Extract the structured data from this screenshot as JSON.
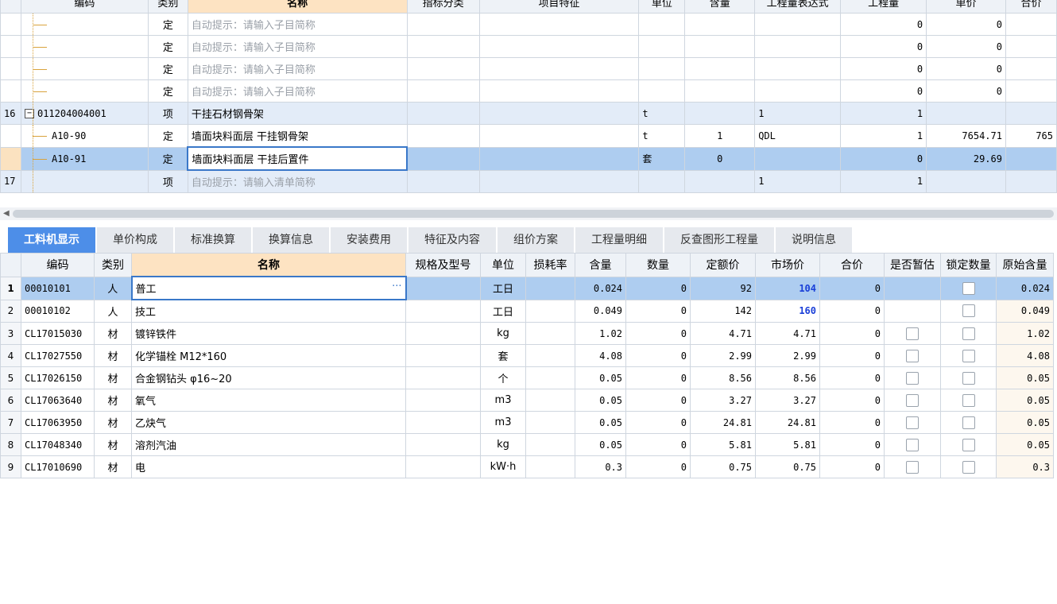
{
  "top_grid": {
    "headers": [
      "编码",
      "类别",
      "名称",
      "指标分类",
      "项目特征",
      "单位",
      "含量",
      "工程量表达式",
      "工程量",
      "单价",
      "合价"
    ],
    "rows": [
      {
        "rownum": "",
        "code": "",
        "kind": "定",
        "name": "自动提示：请输入子目简称",
        "hint": true,
        "unit": "",
        "content": "",
        "expr": "",
        "qty": "0",
        "price": "0",
        "total": "",
        "style": "normal",
        "level": 2
      },
      {
        "rownum": "",
        "code": "",
        "kind": "定",
        "name": "自动提示：请输入子目简称",
        "hint": true,
        "unit": "",
        "content": "",
        "expr": "",
        "qty": "0",
        "price": "0",
        "total": "",
        "style": "normal",
        "level": 2
      },
      {
        "rownum": "",
        "code": "",
        "kind": "定",
        "name": "自动提示：请输入子目简称",
        "hint": true,
        "unit": "",
        "content": "",
        "expr": "",
        "qty": "0",
        "price": "0",
        "total": "",
        "style": "normal",
        "level": 2
      },
      {
        "rownum": "",
        "code": "",
        "kind": "定",
        "name": "自动提示：请输入子目简称",
        "hint": true,
        "unit": "",
        "content": "",
        "expr": "",
        "qty": "0",
        "price": "0",
        "total": "",
        "style": "normal",
        "level": 2
      },
      {
        "rownum": "16",
        "code": "011204004001",
        "kind": "项",
        "name": "干挂石材钢骨架",
        "hint": false,
        "unit": "t",
        "content": "",
        "expr": "1",
        "qty": "1",
        "price": "",
        "total": "",
        "style": "item",
        "level": 1
      },
      {
        "rownum": "",
        "code": "A10-90",
        "kind": "定",
        "name": "墙面块料面层 干挂钢骨架",
        "hint": false,
        "unit": "t",
        "content": "1",
        "expr": "QDL",
        "qty": "1",
        "price": "7654.71",
        "total": "765",
        "style": "normal",
        "level": 2
      },
      {
        "rownum": "",
        "code": "A10-91",
        "kind": "定",
        "name": "墙面块料面层 干挂后置件",
        "hint": false,
        "unit": "套",
        "content": "0",
        "expr": "",
        "qty": "0",
        "price": "29.69",
        "total": "",
        "style": "selected",
        "level": 2
      },
      {
        "rownum": "17",
        "code": "",
        "kind": "项",
        "name": "自动提示：请输入清单简称",
        "hint": true,
        "unit": "",
        "content": "",
        "expr": "1",
        "qty": "1",
        "price": "",
        "total": "",
        "style": "item",
        "level": 1
      }
    ]
  },
  "tabs": [
    "工料机显示",
    "单价构成",
    "标准换算",
    "换算信息",
    "安装费用",
    "特征及内容",
    "组价方案",
    "工程量明细",
    "反查图形工程量",
    "说明信息"
  ],
  "active_tab": 0,
  "bottom_grid": {
    "headers": [
      "编码",
      "类别",
      "名称",
      "规格及型号",
      "单位",
      "损耗率",
      "含量",
      "数量",
      "定额价",
      "市场价",
      "合价",
      "是否暂估",
      "锁定数量",
      "原始含量"
    ],
    "rows": [
      {
        "n": "1",
        "code": "00010101",
        "kind": "人",
        "name": "普工",
        "spec": "",
        "unit": "工日",
        "loss": "",
        "content": "0.024",
        "qty": "0",
        "quota": "92",
        "market": "104",
        "total": "0",
        "est": false,
        "lock": true,
        "orig": "0.024",
        "selected": true,
        "market_blue": true
      },
      {
        "n": "2",
        "code": "00010102",
        "kind": "人",
        "name": "技工",
        "spec": "",
        "unit": "工日",
        "loss": "",
        "content": "0.049",
        "qty": "0",
        "quota": "142",
        "market": "160",
        "total": "0",
        "est": false,
        "lock": true,
        "orig": "0.049",
        "selected": false,
        "market_blue": true
      },
      {
        "n": "3",
        "code": "CL17015030",
        "kind": "材",
        "name": "镀锌铁件",
        "spec": "",
        "unit": "kg",
        "loss": "",
        "content": "1.02",
        "qty": "0",
        "quota": "4.71",
        "market": "4.71",
        "total": "0",
        "est": true,
        "lock": true,
        "orig": "1.02",
        "selected": false,
        "market_blue": false
      },
      {
        "n": "4",
        "code": "CL17027550",
        "kind": "材",
        "name": "化学锚栓 M12*160",
        "spec": "",
        "unit": "套",
        "loss": "",
        "content": "4.08",
        "qty": "0",
        "quota": "2.99",
        "market": "2.99",
        "total": "0",
        "est": true,
        "lock": true,
        "orig": "4.08",
        "selected": false,
        "market_blue": false
      },
      {
        "n": "5",
        "code": "CL17026150",
        "kind": "材",
        "name": "合金钢钻头 φ16~20",
        "spec": "",
        "unit": "个",
        "loss": "",
        "content": "0.05",
        "qty": "0",
        "quota": "8.56",
        "market": "8.56",
        "total": "0",
        "est": true,
        "lock": true,
        "orig": "0.05",
        "selected": false,
        "market_blue": false
      },
      {
        "n": "6",
        "code": "CL17063640",
        "kind": "材",
        "name": "氧气",
        "spec": "",
        "unit": "m3",
        "loss": "",
        "content": "0.05",
        "qty": "0",
        "quota": "3.27",
        "market": "3.27",
        "total": "0",
        "est": true,
        "lock": true,
        "orig": "0.05",
        "selected": false,
        "market_blue": false
      },
      {
        "n": "7",
        "code": "CL17063950",
        "kind": "材",
        "name": "乙炔气",
        "spec": "",
        "unit": "m3",
        "loss": "",
        "content": "0.05",
        "qty": "0",
        "quota": "24.81",
        "market": "24.81",
        "total": "0",
        "est": true,
        "lock": true,
        "orig": "0.05",
        "selected": false,
        "market_blue": false
      },
      {
        "n": "8",
        "code": "CL17048340",
        "kind": "材",
        "name": "溶剂汽油",
        "spec": "",
        "unit": "kg",
        "loss": "",
        "content": "0.05",
        "qty": "0",
        "quota": "5.81",
        "market": "5.81",
        "total": "0",
        "est": true,
        "lock": true,
        "orig": "0.05",
        "selected": false,
        "market_blue": false
      },
      {
        "n": "9",
        "code": "CL17010690",
        "kind": "材",
        "name": "电",
        "spec": "",
        "unit": "kW·h",
        "loss": "",
        "content": "0.3",
        "qty": "0",
        "quota": "0.75",
        "market": "0.75",
        "total": "0",
        "est": true,
        "lock": true,
        "orig": "0.3",
        "selected": false,
        "market_blue": false
      }
    ]
  },
  "icons": {
    "collapse": "minus-box-icon",
    "ellipsis": "ellipsis-icon",
    "scroll_left": "left-arrow-icon"
  },
  "colors": {
    "active_tab": "#4d8ee8",
    "selection": "#aecdf0",
    "name_header": "#fde3c2",
    "market_highlight": "#1a3fd8"
  }
}
